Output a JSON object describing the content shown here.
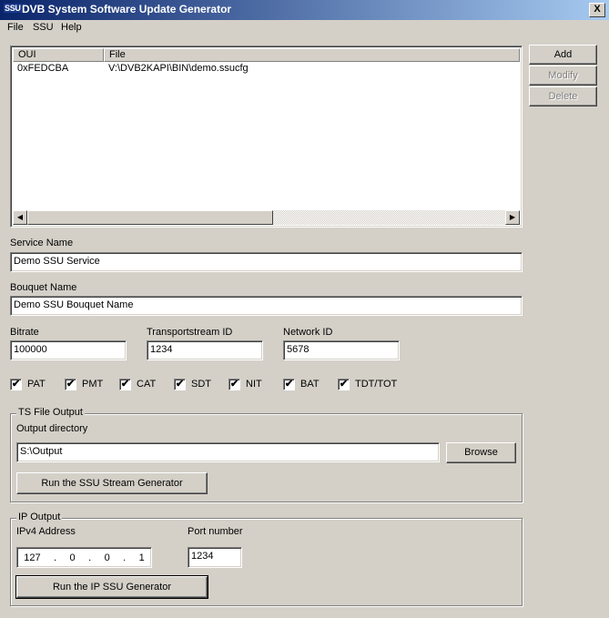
{
  "window": {
    "icon_text": "SSU",
    "title": "DVB System Software Update Generator",
    "close_glyph": "X"
  },
  "menu": [
    {
      "label": "File"
    },
    {
      "label": "SSU"
    },
    {
      "label": "Help"
    }
  ],
  "list": {
    "columns": [
      "OUI",
      "File"
    ],
    "rows": [
      {
        "oui": "0xFEDCBA",
        "file": "V:\\DVB2KAPI\\BIN\\demo.ssucfg"
      }
    ]
  },
  "side_buttons": {
    "add": "Add",
    "modify": "Modify",
    "delete": "Delete"
  },
  "service": {
    "label": "Service Name",
    "value": "Demo SSU Service"
  },
  "bouquet": {
    "label": "Bouquet Name",
    "value": "Demo SSU Bouquet Name"
  },
  "bitrate": {
    "label": "Bitrate",
    "value": "100000"
  },
  "ts_id": {
    "label": "Transportstream ID",
    "value": "1234"
  },
  "network_id": {
    "label": "Network ID",
    "value": "5678"
  },
  "tables": [
    {
      "label": "PAT",
      "checked": true
    },
    {
      "label": "PMT",
      "checked": true
    },
    {
      "label": "CAT",
      "checked": true
    },
    {
      "label": "SDT",
      "checked": true
    },
    {
      "label": "NIT",
      "checked": true
    },
    {
      "label": "BAT",
      "checked": true
    },
    {
      "label": "TDT/TOT",
      "checked": true
    }
  ],
  "check_glyph": "✔",
  "ts_output": {
    "group_title": "TS File Output",
    "dir_label": "Output directory",
    "dir_value": "S:\\Output",
    "browse": "Browse",
    "run": "Run the SSU Stream Generator"
  },
  "ip_output": {
    "group_title": "IP Output",
    "ip_label": "IPv4 Address",
    "ip_octets": [
      "127",
      "0",
      "0",
      "1"
    ],
    "port_label": "Port number",
    "port_value": "1234",
    "run": "Run the IP SSU Generator"
  }
}
